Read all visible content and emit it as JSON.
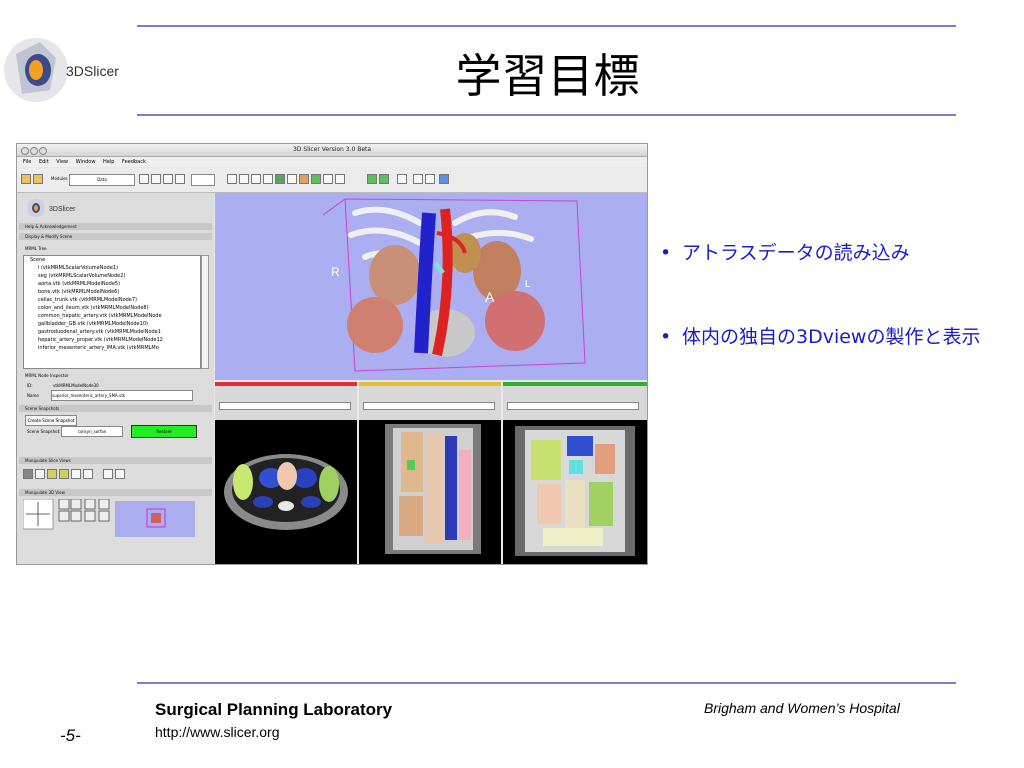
{
  "slide": {
    "title": "学習目標",
    "logo_text": "3DSlicer",
    "bullets": [
      "アトラスデータの読み込み",
      "体内の独自の3Dviewの製作と表示"
    ],
    "footer": {
      "lab": "Surgical Planning Laboratory",
      "url": "http://www.slicer.org",
      "hospital": "Brigham and Women’s Hospital",
      "page": "-5-"
    },
    "accent_color": "#7b7bd8",
    "bullet_color": "#1a1acc"
  },
  "app": {
    "window_title": "3D Slicer Version 3.0 Beta",
    "menu": [
      "File",
      "Edit",
      "View",
      "Window",
      "Help",
      "Feedback"
    ],
    "module_label": "Modules",
    "module_value": "Data",
    "logo_text": "3DSlicer",
    "sections": {
      "help": "Help & Acknowledgement",
      "display": "Display & Modify Scene",
      "mrml_tree": "MRML Tree",
      "node_inspector": "MRML Node Inspector",
      "scene_snapshots": "Scene Snapshots",
      "manip_slice": "Manipulate Slice Views",
      "manip_3d": "Manipulate 3D View"
    },
    "tree": {
      "root": "Scene",
      "items": [
        "l (vtkMRMLScalarVolumeNode1)",
        "seg (vtkMRMLScalarVolumeNode2)",
        "aorta.vtk (vtkMRMLModelNode5)",
        "bone.vtk (vtkMRMLModelNode6)",
        "celiac_trunk.vtk (vtkMRMLModelNode7)",
        "colon_and_ileum.vtk (vtkMRMLModelNode8)",
        "common_hepatic_artery.vtk (vtkMRMLModelNode",
        "gallbladder_GB.vtk (vtkMRMLModelNode10)",
        "gastroduodenal_artery.vtk (vtkMRMLModelNode1",
        "hepatic_artery_proper.vtk (vtkMRMLModelNode12",
        "inferior_mesenteric_artery_IMA.vtk (vtkMRMLMo"
      ]
    },
    "node_id_label": "ID:",
    "node_id_value": "vtkMRMLModelNode30",
    "node_name_label": "Name",
    "node_name_value": "superior_mesenteric_artery_SMA.vtk",
    "snapshot_button": "Create Scene Snapshot",
    "snapshot_label": "Scene Snapshot:",
    "snapshot_value": "colisyn_sorfan",
    "restore_button": "Restore",
    "view_labels": {
      "r": "R",
      "a": "A",
      "l": "L"
    },
    "slice_colors": [
      "#e03030",
      "#e0c030",
      "#30b030"
    ]
  }
}
